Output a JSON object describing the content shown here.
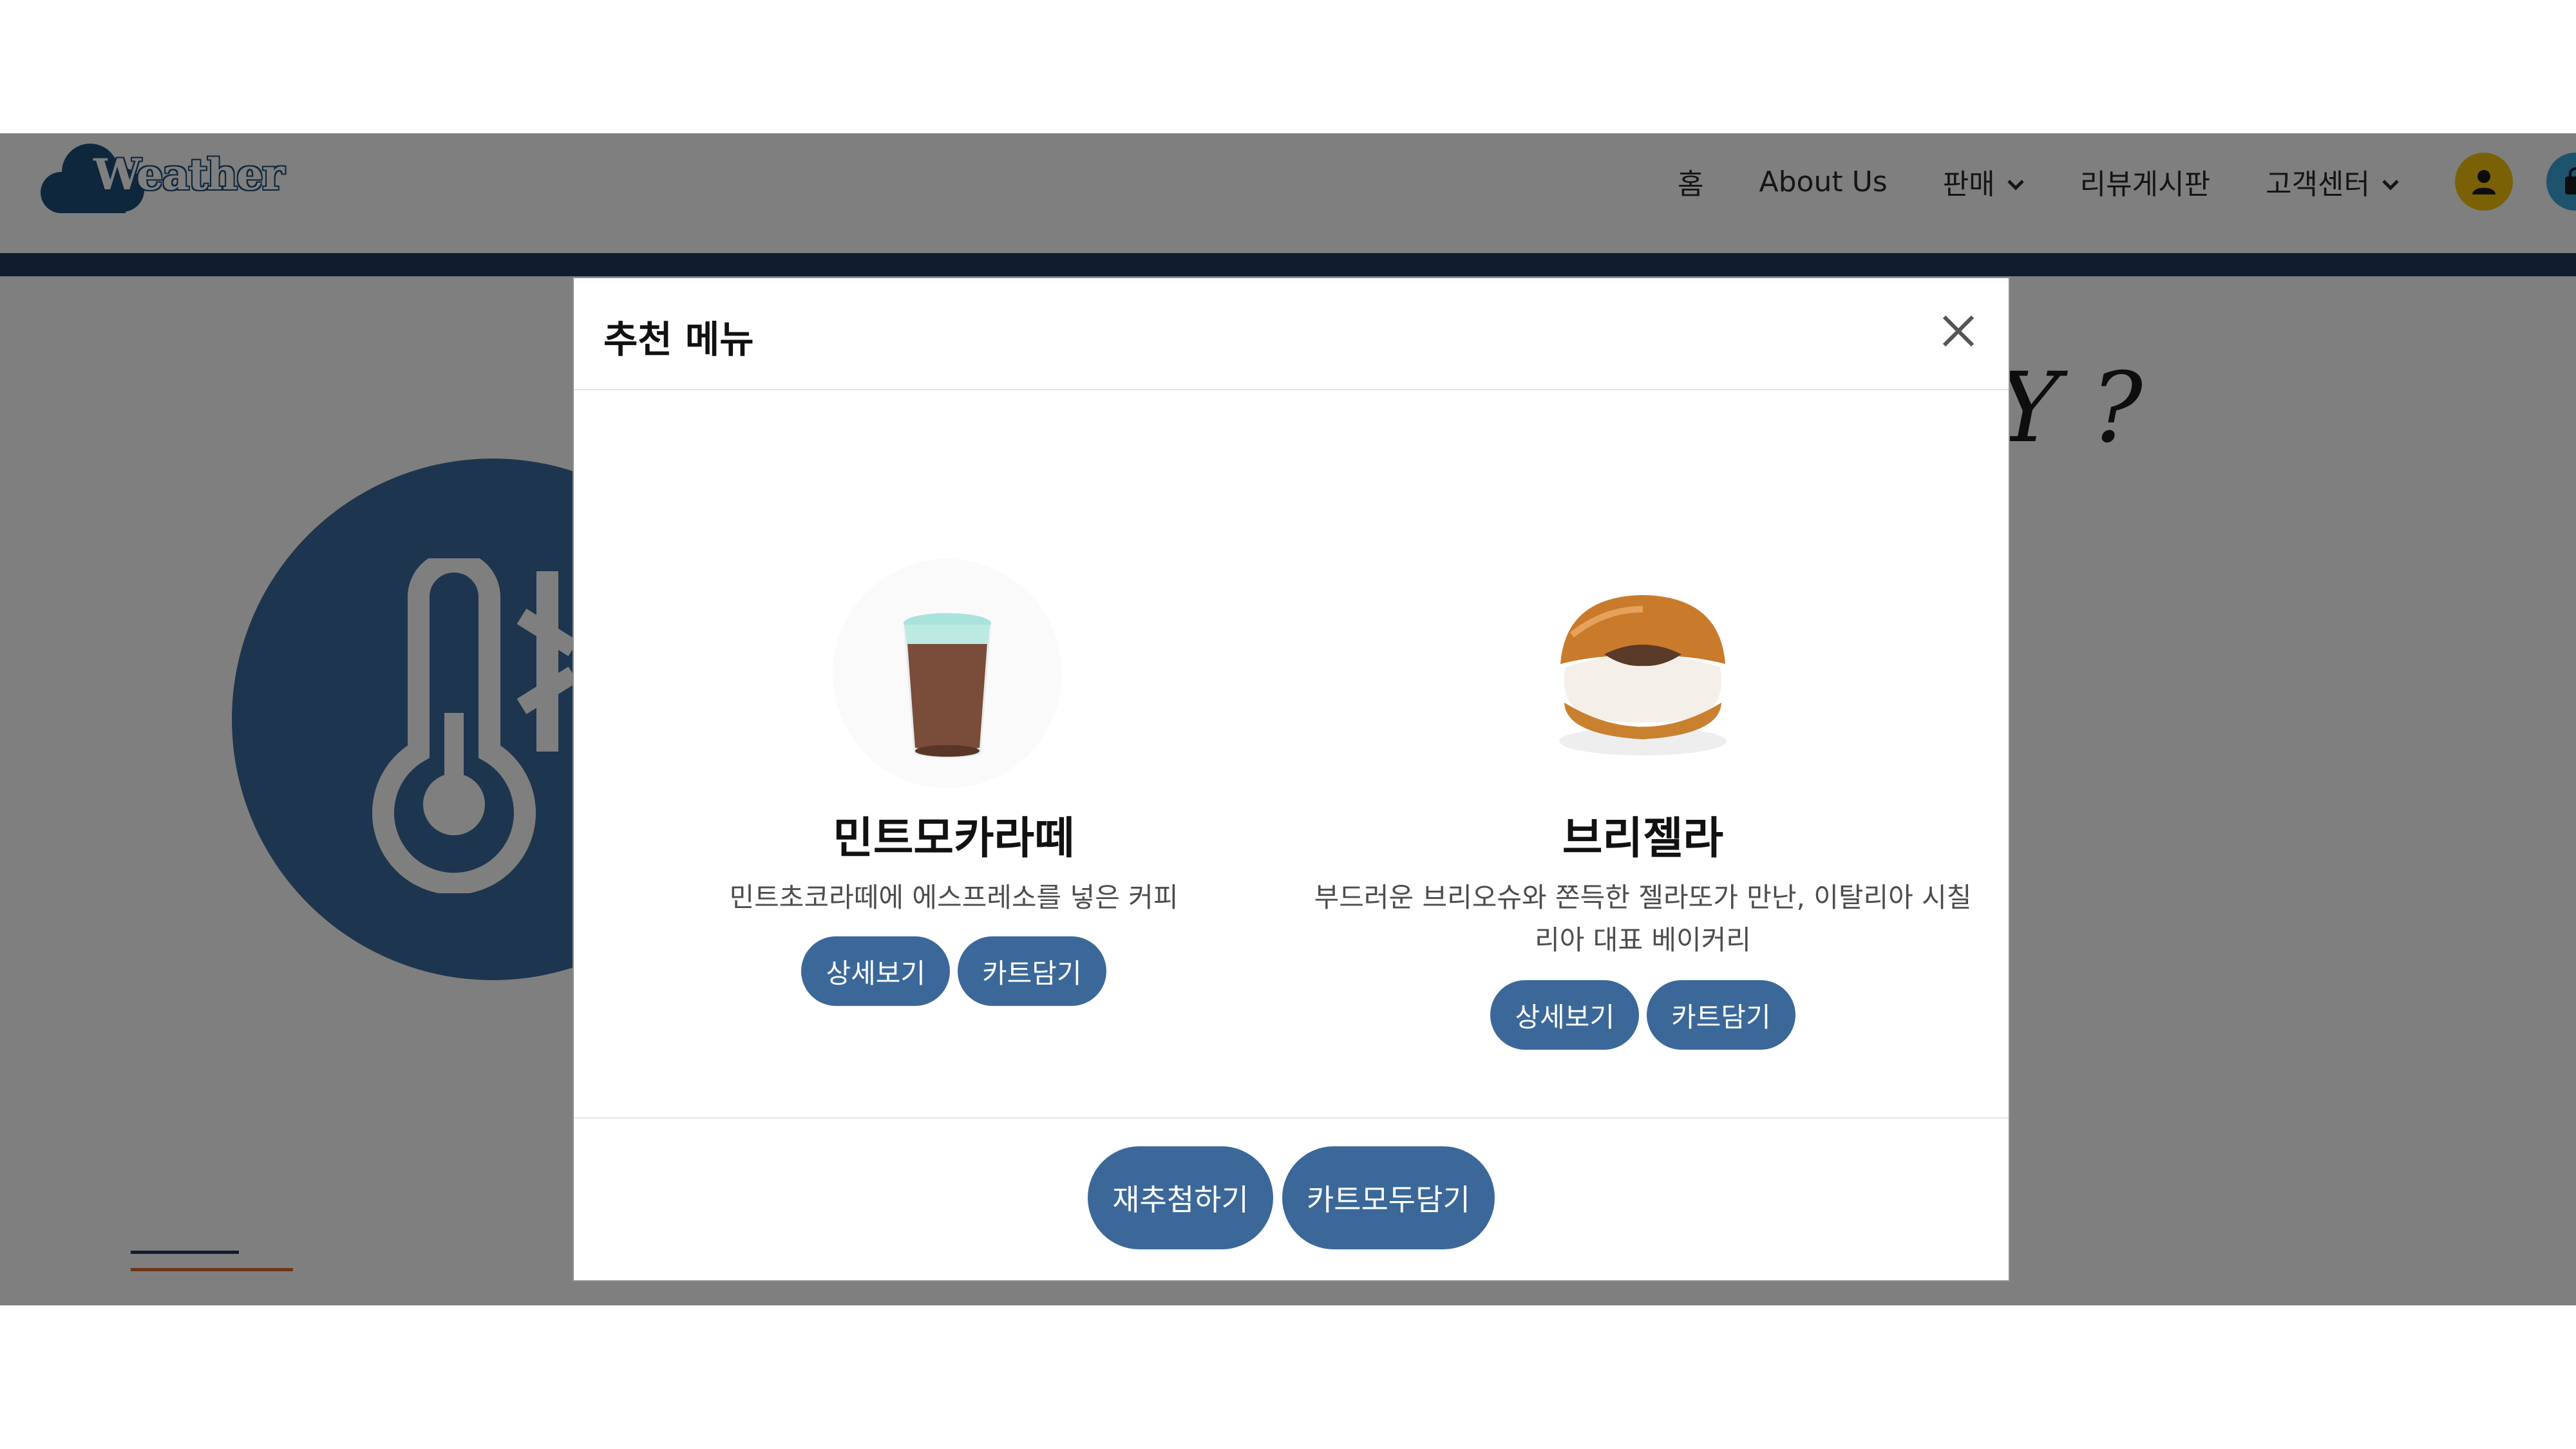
{
  "header": {
    "logo_text": "Weather",
    "nav": {
      "home": "홈",
      "about": "About Us",
      "sales": "판매",
      "reviews": "리뷰게시판",
      "support": "고객센터"
    },
    "icons": [
      "user-icon",
      "shopping-bag-icon",
      "chevron-down-icon"
    ],
    "bar_color": "#1f3b5c"
  },
  "hero": {
    "heading_fragment": "Y ?",
    "circle_color": "#3c6a9e",
    "icon": "thermometer-snowflake-icon"
  },
  "modal": {
    "title": "추천 메뉴",
    "close_icon": "close-icon",
    "items": [
      {
        "name": "민트모카라떼",
        "description": "민트초코라떼에 에스프레소를 넣은 커피",
        "image": "mint-mocha-latte-glass",
        "detail_label": "상세보기",
        "cart_label": "카트담기"
      },
      {
        "name": "브리젤라",
        "description": "부드러운 브리오슈와 쫀득한 젤라또가 만난, 이탈리아 시칠리아 대표 베이커리",
        "image": "brioche-gelato-bun",
        "detail_label": "상세보기",
        "cart_label": "카트담기"
      }
    ],
    "footer": {
      "redraw_label": "재추첨하기",
      "add_all_label": "카트모두담기"
    },
    "button_color": "#3b6899"
  }
}
